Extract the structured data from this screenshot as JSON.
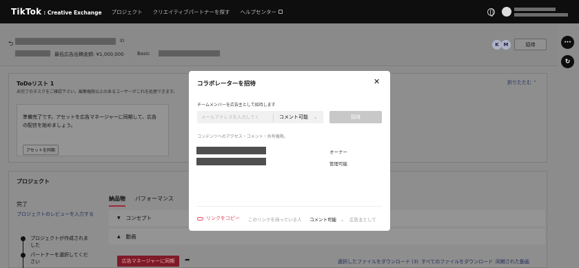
{
  "topnav": {
    "brand": "TikTok",
    "brand_sub": ": Creative Exchange",
    "links": [
      "プロジェクト",
      "クリエイティブパートナーを探す",
      "ヘルプセンター"
    ]
  },
  "header": {
    "id_label": "ID",
    "budget": "最低広告出稿金額: ¥1,000,000",
    "plan": "Basic",
    "avatars": [
      "K",
      "M"
    ],
    "invite_label": "招待"
  },
  "todo": {
    "title": "ToDoリスト 1",
    "subtitle": "未完了のタスクをご確認下さい。編集権限以上のあるユーザーがこれを処理できます。",
    "collapse_label": "折りたたむ",
    "message": "準備完了です。アセットを広告マネージャーに同期して、広告の配信を始めましょう。",
    "sync_button": "アセットを同期"
  },
  "project": {
    "title": "プロジェクト",
    "status": "完了",
    "review_link": "プロジェクトのレビューを入力する",
    "timeline": [
      "プロジェクトが作成されました",
      "パートナーを選択してください"
    ],
    "tabs": [
      "納品物",
      "パフォーマンス"
    ],
    "sections": [
      "コンセプト",
      "動画"
    ],
    "sync_ads_button": "広告マネージャーに同期",
    "bottom_links": [
      "選択したファイルをダウンロード (3)",
      "すべてのファイルをダウンロード",
      "同期された動画"
    ]
  },
  "modal": {
    "title": "コラボレーターを招待",
    "member_label": "チームメンバーを広告主として招待します",
    "email_placeholder": "メールアドレスを入力してく",
    "permission": "コメント可能",
    "invite_button": "招待",
    "access_label": "コンテンツへのアクセス・コメント・共有権限。",
    "members": [
      {
        "role": "オーナー"
      },
      {
        "role": "管理可能"
      }
    ],
    "copy_link": "リンクをコピー",
    "footer_text": "このリンクを持っている人",
    "footer_perm": "コメント可能",
    "footer_suffix": "広告主として"
  },
  "colors": {
    "accent": "#e0465c",
    "link": "#1f2a5a",
    "overlay": "#8c8c8c"
  }
}
